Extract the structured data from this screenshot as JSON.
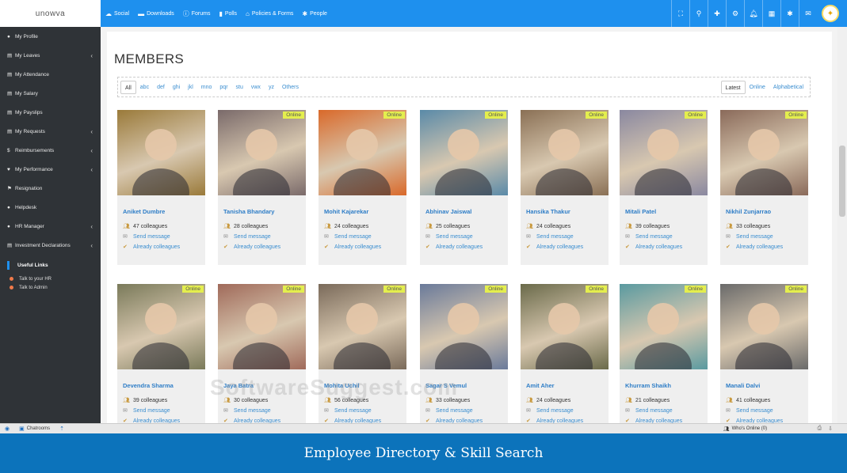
{
  "app": {
    "logo": "unowva"
  },
  "topnav": [
    {
      "label": "Social",
      "icon": "☁"
    },
    {
      "label": "Downloads",
      "icon": "▬"
    },
    {
      "label": "Forums",
      "icon": "ⓘ"
    },
    {
      "label": "Polls",
      "icon": "▮"
    },
    {
      "label": "Policies & Forms",
      "icon": "⌂"
    },
    {
      "label": "People",
      "icon": "✱"
    }
  ],
  "sidebar": {
    "items": [
      {
        "label": "My Profile",
        "icon": "●",
        "chevron": false
      },
      {
        "label": "My Leaves",
        "icon": "▤",
        "chevron": true
      },
      {
        "label": "My Attendance",
        "icon": "▤",
        "chevron": false
      },
      {
        "label": "My Salary",
        "icon": "▤",
        "chevron": false
      },
      {
        "label": "My Payslips",
        "icon": "▤",
        "chevron": false
      },
      {
        "label": "My Requests",
        "icon": "▤",
        "chevron": true
      },
      {
        "label": "Reimbursements",
        "icon": "$",
        "chevron": true
      },
      {
        "label": "My Performance",
        "icon": "♥",
        "chevron": true
      },
      {
        "label": "Resignation",
        "icon": "⚑",
        "chevron": false
      },
      {
        "label": "Helpdesk",
        "icon": "●",
        "chevron": false
      },
      {
        "label": "HR Manager",
        "icon": "●",
        "chevron": true
      },
      {
        "label": "Investment Declarations",
        "icon": "▤",
        "chevron": true
      }
    ],
    "useful_links_title": "Useful Links",
    "links": [
      "Talk to your HR",
      "Talk to Admin"
    ]
  },
  "main": {
    "title": "MEMBERS",
    "alpha_filters": [
      "All",
      "abc",
      "def",
      "ghi",
      "jkl",
      "mno",
      "pqr",
      "stu",
      "vwx",
      "yz",
      "Others"
    ],
    "sort_options": [
      "Latest",
      "Online",
      "Alphabetical"
    ],
    "send_message_label": "Send message",
    "already_label": "Already colleagues",
    "online_label": "Online",
    "members": [
      {
        "name": "Aniket Dumbre",
        "colleagues": "47 colleagues",
        "online": false,
        "color": "#9a7a3a"
      },
      {
        "name": "Tanisha Bhandary",
        "colleagues": "28 colleagues",
        "online": true,
        "color": "#7a6a6a"
      },
      {
        "name": "Mohit Kajarekar",
        "colleagues": "24 colleagues",
        "online": true,
        "color": "#d9692a"
      },
      {
        "name": "Abhinav Jaiswal",
        "colleagues": "25 colleagues",
        "online": true,
        "color": "#5a8aa8"
      },
      {
        "name": "Hansika Thakur",
        "colleagues": "24 colleagues",
        "online": true,
        "color": "#8a7055"
      },
      {
        "name": "Mitali Patel",
        "colleagues": "39 colleagues",
        "online": true,
        "color": "#8a88a0"
      },
      {
        "name": "Nikhil Zunjarrao",
        "colleagues": "33 colleagues",
        "online": true,
        "color": "#8a6a5a"
      },
      {
        "name": "Devendra Sharma",
        "colleagues": "39 colleagues",
        "online": true,
        "color": "#7a7a5a"
      },
      {
        "name": "Jaya Batra",
        "colleagues": "30 colleagues",
        "online": true,
        "color": "#a06a5a"
      },
      {
        "name": "Mohita Uchil",
        "colleagues": "56 colleagues",
        "online": true,
        "color": "#7a6a5a"
      },
      {
        "name": "Sagar S Vemul",
        "colleagues": "33 colleagues",
        "online": true,
        "color": "#6a7a9a"
      },
      {
        "name": "Amit Aher",
        "colleagues": "24 colleagues",
        "online": true,
        "color": "#6a6a4a"
      },
      {
        "name": "Khurram Shaikh",
        "colleagues": "21 colleagues",
        "online": true,
        "color": "#5a9aa0"
      },
      {
        "name": "Manali Dalvi",
        "colleagues": "41 colleagues",
        "online": true,
        "color": "#6a6a6a"
      }
    ]
  },
  "statusbar": {
    "chatrooms": "Chatrooms",
    "whos_online": "Who's Online (0)"
  },
  "caption": "Employee Directory & Skill Search",
  "watermark": "SoftwareSuggest.com"
}
